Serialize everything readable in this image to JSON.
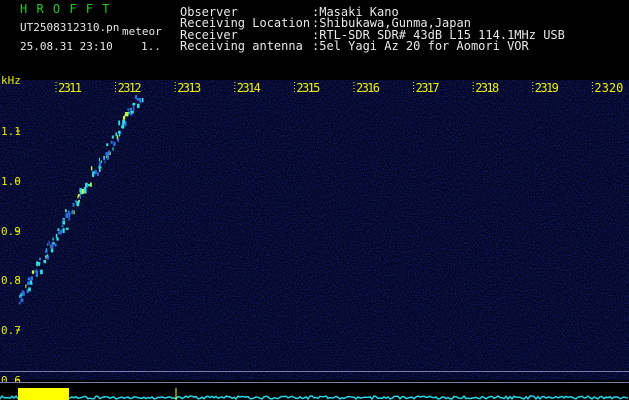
{
  "app": {
    "name": "H R O F F T",
    "filename": "UT2508312310.pn",
    "mode": "meteor",
    "date_time": "25.08.31 23:10",
    "page": "1.."
  },
  "info": [
    {
      "label": "Observer",
      "value": ":Masaki Kano"
    },
    {
      "label": "Receiving Location",
      "value": ":Shibukawa,Gunma,Japan"
    },
    {
      "label": "Receiver",
      "value": ":RTL-SDR SDR# 43dB L15 114.1MHz USB"
    },
    {
      "label": "Receiving antenna",
      "value": ":5el Yagi Az 20 for Aomori VOR"
    }
  ],
  "axes": {
    "y_unit": "kHz",
    "y_ticks": [
      "1.1",
      "1.0",
      "0.9",
      "0.8",
      "0.7",
      "0.6"
    ],
    "x_ticks": [
      "2311",
      "2312",
      "2313",
      "2314",
      "2315",
      "2316",
      "2317",
      "2318",
      "2319",
      "2320"
    ]
  },
  "colors": {
    "header_green": "#22c822",
    "header_white": "#e8e8e8",
    "label_yellow": "#e8e800",
    "axis_yellow": "#f0f000",
    "echo_cyan": "#2ee0e0",
    "baseline_cyan": "#28d8e8",
    "signal_yellow": "#ffff00",
    "background": "#000000"
  }
}
